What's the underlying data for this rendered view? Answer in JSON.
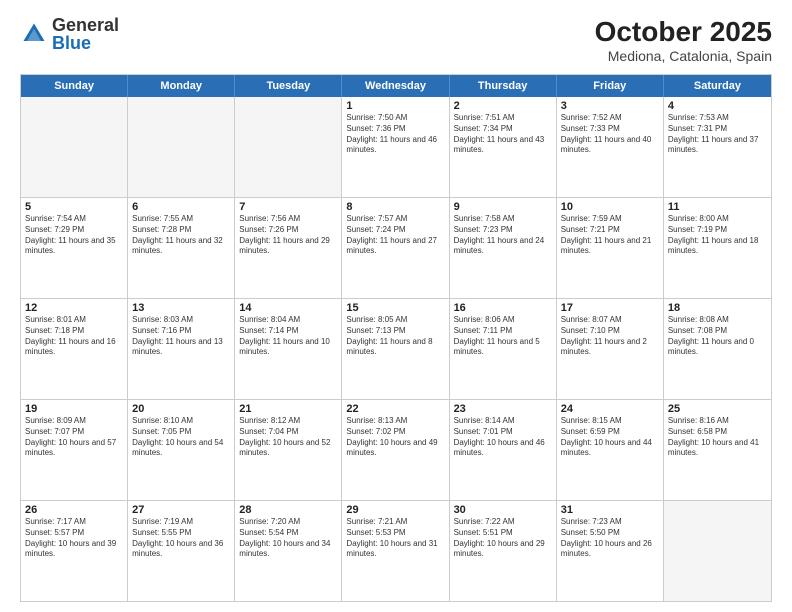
{
  "header": {
    "logo": {
      "general": "General",
      "blue": "Blue"
    },
    "title": "October 2025",
    "subtitle": "Mediona, Catalonia, Spain"
  },
  "weekdays": [
    "Sunday",
    "Monday",
    "Tuesday",
    "Wednesday",
    "Thursday",
    "Friday",
    "Saturday"
  ],
  "rows": [
    [
      {
        "day": "",
        "text": "",
        "empty": true
      },
      {
        "day": "",
        "text": "",
        "empty": true
      },
      {
        "day": "",
        "text": "",
        "empty": true
      },
      {
        "day": "1",
        "text": "Sunrise: 7:50 AM\nSunset: 7:36 PM\nDaylight: 11 hours and 46 minutes."
      },
      {
        "day": "2",
        "text": "Sunrise: 7:51 AM\nSunset: 7:34 PM\nDaylight: 11 hours and 43 minutes."
      },
      {
        "day": "3",
        "text": "Sunrise: 7:52 AM\nSunset: 7:33 PM\nDaylight: 11 hours and 40 minutes."
      },
      {
        "day": "4",
        "text": "Sunrise: 7:53 AM\nSunset: 7:31 PM\nDaylight: 11 hours and 37 minutes."
      }
    ],
    [
      {
        "day": "5",
        "text": "Sunrise: 7:54 AM\nSunset: 7:29 PM\nDaylight: 11 hours and 35 minutes."
      },
      {
        "day": "6",
        "text": "Sunrise: 7:55 AM\nSunset: 7:28 PM\nDaylight: 11 hours and 32 minutes."
      },
      {
        "day": "7",
        "text": "Sunrise: 7:56 AM\nSunset: 7:26 PM\nDaylight: 11 hours and 29 minutes."
      },
      {
        "day": "8",
        "text": "Sunrise: 7:57 AM\nSunset: 7:24 PM\nDaylight: 11 hours and 27 minutes."
      },
      {
        "day": "9",
        "text": "Sunrise: 7:58 AM\nSunset: 7:23 PM\nDaylight: 11 hours and 24 minutes."
      },
      {
        "day": "10",
        "text": "Sunrise: 7:59 AM\nSunset: 7:21 PM\nDaylight: 11 hours and 21 minutes."
      },
      {
        "day": "11",
        "text": "Sunrise: 8:00 AM\nSunset: 7:19 PM\nDaylight: 11 hours and 18 minutes."
      }
    ],
    [
      {
        "day": "12",
        "text": "Sunrise: 8:01 AM\nSunset: 7:18 PM\nDaylight: 11 hours and 16 minutes."
      },
      {
        "day": "13",
        "text": "Sunrise: 8:03 AM\nSunset: 7:16 PM\nDaylight: 11 hours and 13 minutes."
      },
      {
        "day": "14",
        "text": "Sunrise: 8:04 AM\nSunset: 7:14 PM\nDaylight: 11 hours and 10 minutes."
      },
      {
        "day": "15",
        "text": "Sunrise: 8:05 AM\nSunset: 7:13 PM\nDaylight: 11 hours and 8 minutes."
      },
      {
        "day": "16",
        "text": "Sunrise: 8:06 AM\nSunset: 7:11 PM\nDaylight: 11 hours and 5 minutes."
      },
      {
        "day": "17",
        "text": "Sunrise: 8:07 AM\nSunset: 7:10 PM\nDaylight: 11 hours and 2 minutes."
      },
      {
        "day": "18",
        "text": "Sunrise: 8:08 AM\nSunset: 7:08 PM\nDaylight: 11 hours and 0 minutes."
      }
    ],
    [
      {
        "day": "19",
        "text": "Sunrise: 8:09 AM\nSunset: 7:07 PM\nDaylight: 10 hours and 57 minutes."
      },
      {
        "day": "20",
        "text": "Sunrise: 8:10 AM\nSunset: 7:05 PM\nDaylight: 10 hours and 54 minutes."
      },
      {
        "day": "21",
        "text": "Sunrise: 8:12 AM\nSunset: 7:04 PM\nDaylight: 10 hours and 52 minutes."
      },
      {
        "day": "22",
        "text": "Sunrise: 8:13 AM\nSunset: 7:02 PM\nDaylight: 10 hours and 49 minutes."
      },
      {
        "day": "23",
        "text": "Sunrise: 8:14 AM\nSunset: 7:01 PM\nDaylight: 10 hours and 46 minutes."
      },
      {
        "day": "24",
        "text": "Sunrise: 8:15 AM\nSunset: 6:59 PM\nDaylight: 10 hours and 44 minutes."
      },
      {
        "day": "25",
        "text": "Sunrise: 8:16 AM\nSunset: 6:58 PM\nDaylight: 10 hours and 41 minutes."
      }
    ],
    [
      {
        "day": "26",
        "text": "Sunrise: 7:17 AM\nSunset: 5:57 PM\nDaylight: 10 hours and 39 minutes."
      },
      {
        "day": "27",
        "text": "Sunrise: 7:19 AM\nSunset: 5:55 PM\nDaylight: 10 hours and 36 minutes."
      },
      {
        "day": "28",
        "text": "Sunrise: 7:20 AM\nSunset: 5:54 PM\nDaylight: 10 hours and 34 minutes."
      },
      {
        "day": "29",
        "text": "Sunrise: 7:21 AM\nSunset: 5:53 PM\nDaylight: 10 hours and 31 minutes."
      },
      {
        "day": "30",
        "text": "Sunrise: 7:22 AM\nSunset: 5:51 PM\nDaylight: 10 hours and 29 minutes."
      },
      {
        "day": "31",
        "text": "Sunrise: 7:23 AM\nSunset: 5:50 PM\nDaylight: 10 hours and 26 minutes."
      },
      {
        "day": "",
        "text": "",
        "empty": true
      }
    ]
  ]
}
